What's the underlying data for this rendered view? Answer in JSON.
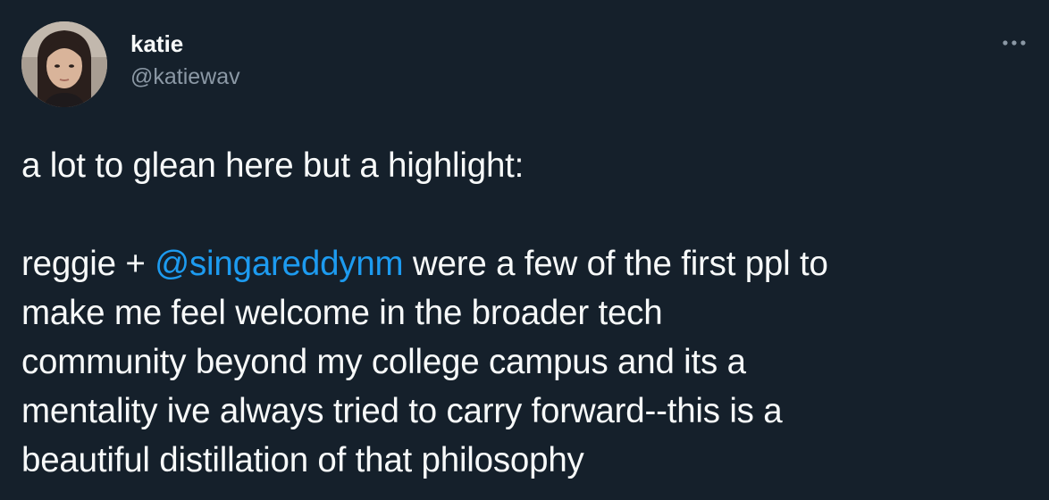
{
  "author": {
    "display_name": "katie",
    "handle": "@katiewav"
  },
  "icons": {
    "more": "more-horizontal-icon",
    "avatar": "profile-photo"
  },
  "colors": {
    "background": "#15202b",
    "text": "#f7f9f9",
    "secondary": "#8b98a5",
    "link": "#1d9bf0"
  },
  "tweet": {
    "line1": "a lot to glean here but a highlight:",
    "line2_prefix": "reggie + ",
    "mention": "@singareddynm",
    "line2_suffix": " were a few of the first ppl to",
    "line3": "make me feel welcome in the broader tech",
    "line4": "community beyond my college campus and its a",
    "line5": "mentality ive always tried to carry forward--this is a",
    "line6": "beautiful distillation of that philosophy"
  }
}
